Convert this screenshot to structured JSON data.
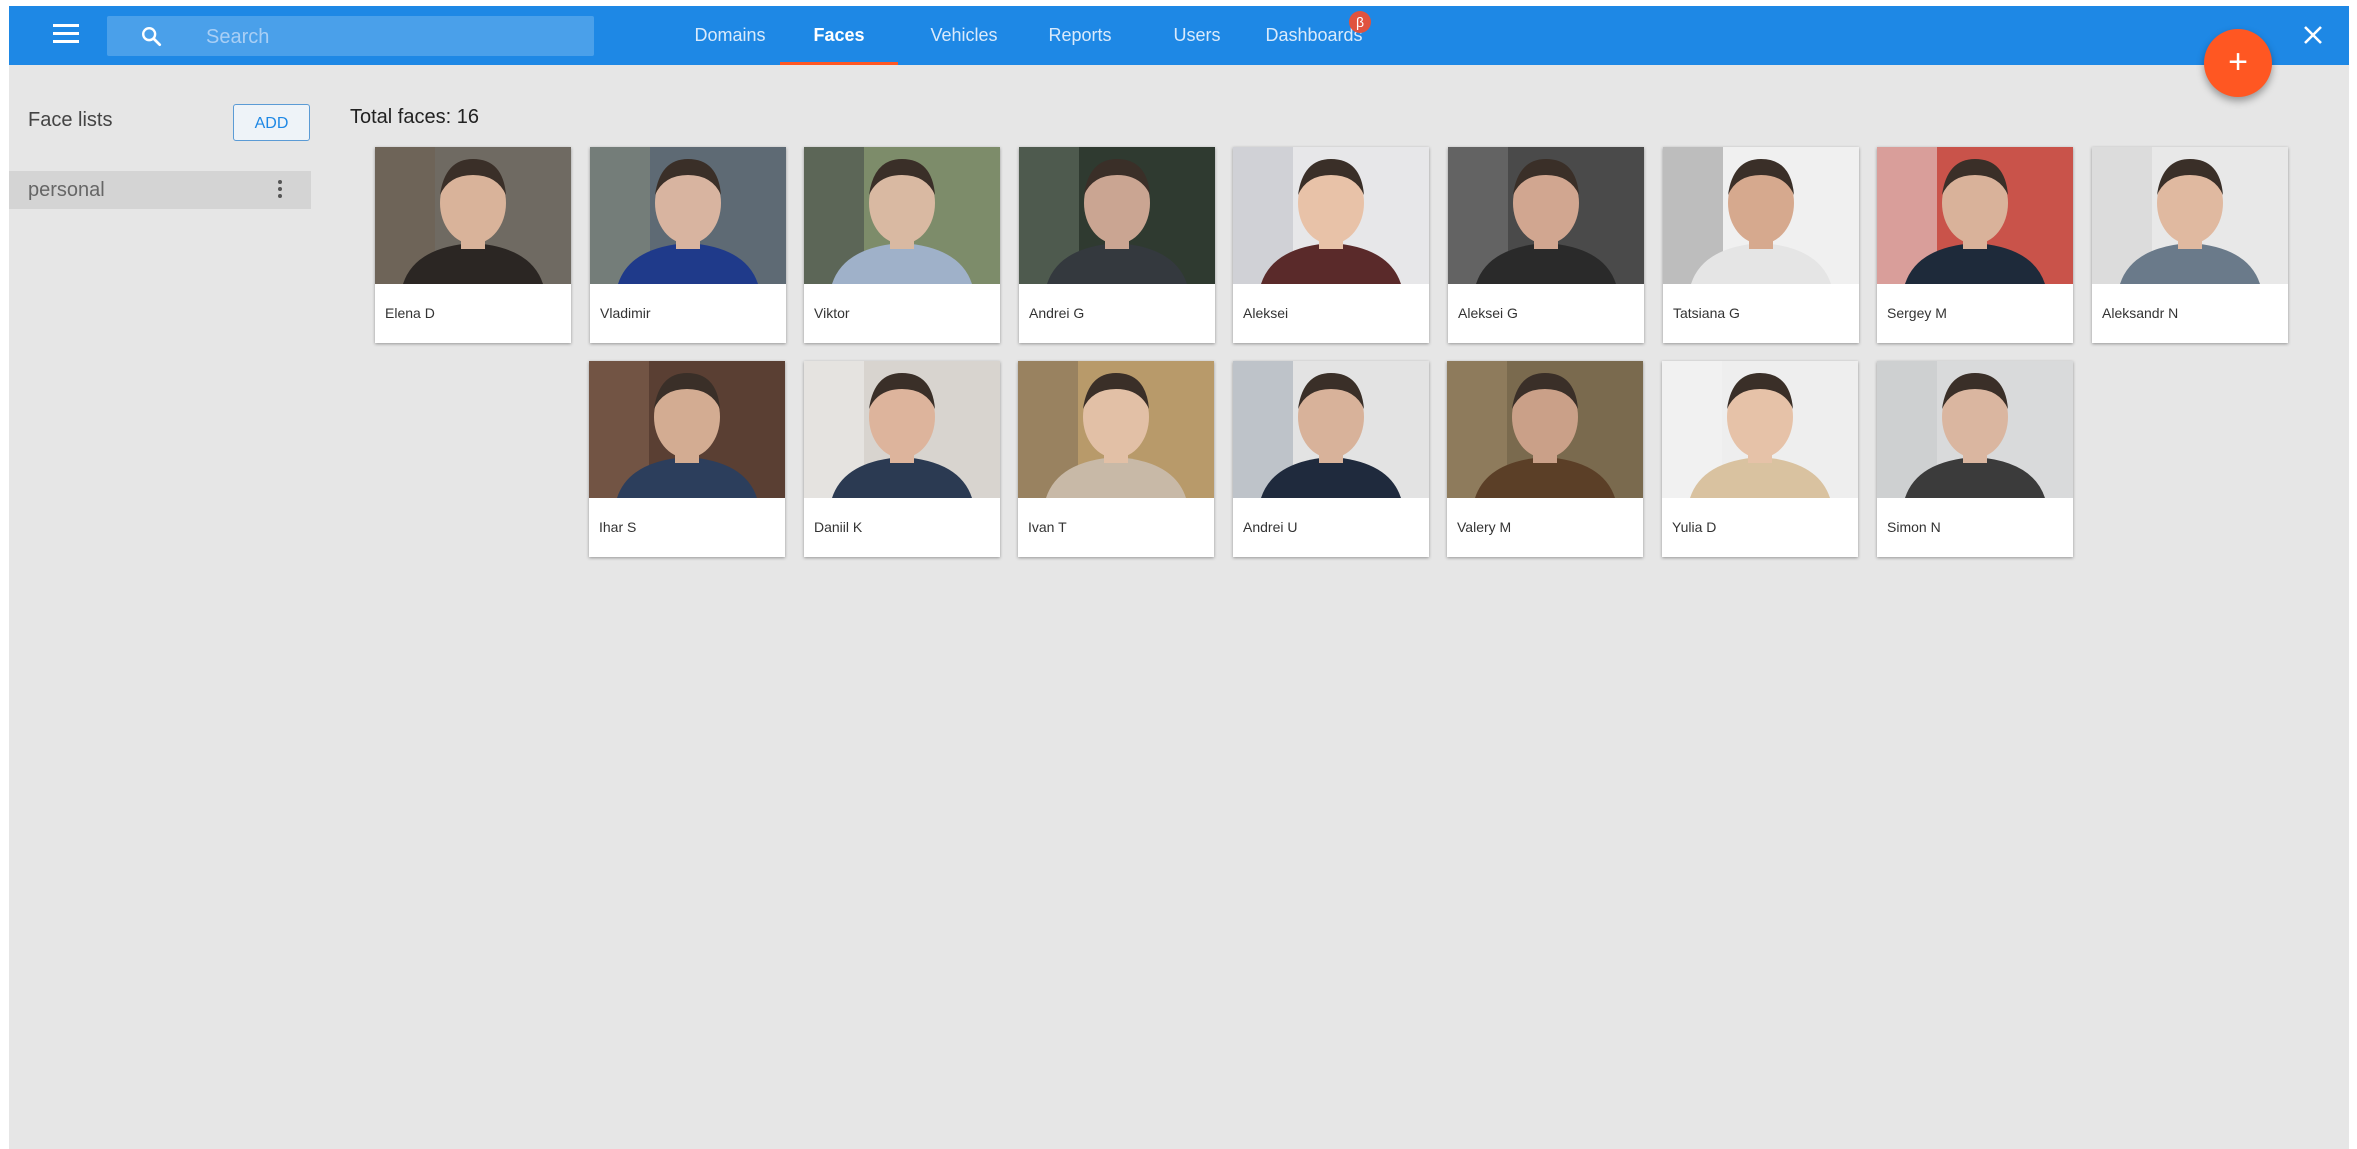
{
  "search": {
    "placeholder": "Search"
  },
  "nav": {
    "tabs": [
      {
        "label": "Domains",
        "active": false
      },
      {
        "label": "Faces",
        "active": true
      },
      {
        "label": "Vehicles",
        "active": false
      },
      {
        "label": "Reports",
        "active": false
      },
      {
        "label": "Users",
        "active": false
      },
      {
        "label": "Dashboards",
        "active": false,
        "badge": "β"
      }
    ]
  },
  "fab": {
    "label": "+"
  },
  "close": {
    "label": "✕"
  },
  "sidebar": {
    "title": "Face lists",
    "add_label": "ADD",
    "lists": [
      {
        "label": "personal"
      }
    ]
  },
  "main": {
    "total_label": "Total faces: 16",
    "faces": [
      {
        "name": "Elena D"
      },
      {
        "name": "Vladimir"
      },
      {
        "name": "Viktor"
      },
      {
        "name": "Andrei G"
      },
      {
        "name": "Aleksei"
      },
      {
        "name": "Aleksei G"
      },
      {
        "name": "Tatsiana G"
      },
      {
        "name": "Sergey M"
      },
      {
        "name": "Aleksandr N"
      },
      {
        "name": "Ihar S"
      },
      {
        "name": "Daniil K"
      },
      {
        "name": "Ivan T"
      },
      {
        "name": "Andrei U"
      },
      {
        "name": "Valery M"
      },
      {
        "name": "Yulia D"
      },
      {
        "name": "Simon N"
      }
    ]
  },
  "colors": {
    "accent": "#1e88e5",
    "fab": "#ff5722",
    "background": "#e6e6e6"
  }
}
